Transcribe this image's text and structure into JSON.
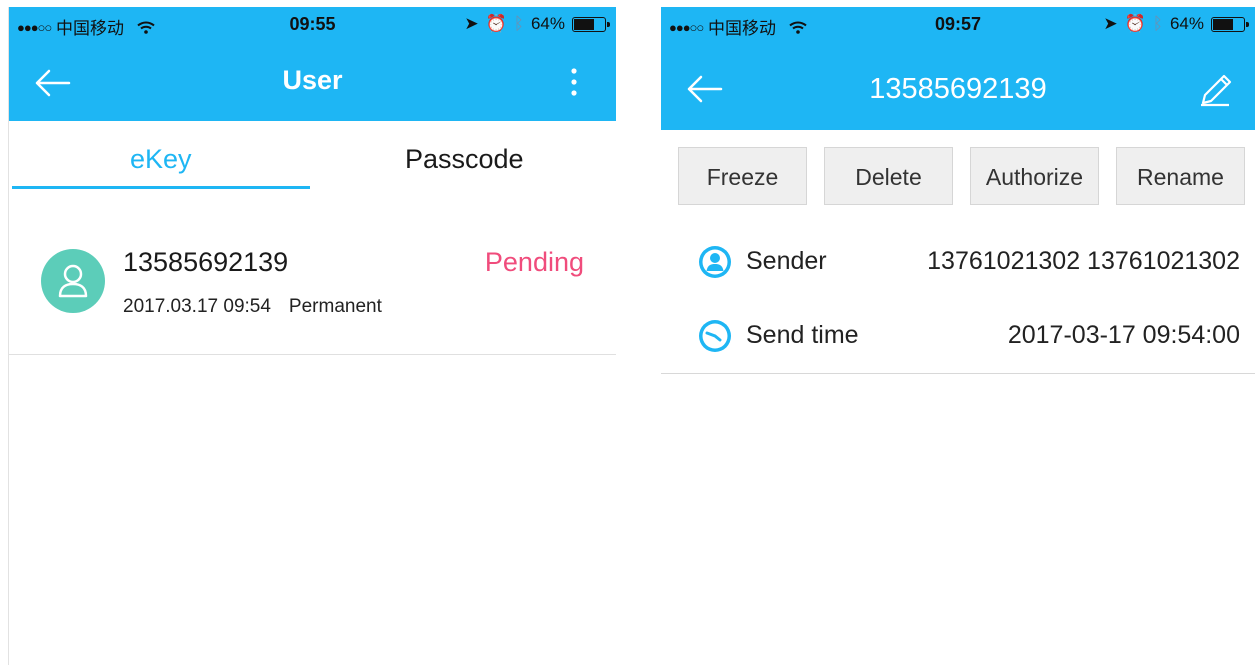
{
  "colors": {
    "accent": "#1eb6f4",
    "pending": "#f04c7c",
    "avatar": "#5ccdb9"
  },
  "left": {
    "status": {
      "carrier": "中国移动",
      "time": "09:55",
      "battery": "64%"
    },
    "nav": {
      "title": "User"
    },
    "tabs": [
      {
        "label": "eKey",
        "active": true
      },
      {
        "label": "Passcode",
        "active": false
      }
    ],
    "key": {
      "phone": "13585692139",
      "date": "2017.03.17 09:54",
      "validity": "Permanent",
      "status": "Pending"
    }
  },
  "right": {
    "status": {
      "carrier": "中国移动",
      "time": "09:57",
      "battery": "64%"
    },
    "nav": {
      "title": "13585692139"
    },
    "actions": [
      "Freeze",
      "Delete",
      "Authorize",
      "Rename"
    ],
    "info": {
      "sender_label": "Sender",
      "sender_value": "13761021302 13761021302",
      "send_time_label": "Send time",
      "send_time_value": "2017-03-17 09:54:00"
    }
  }
}
